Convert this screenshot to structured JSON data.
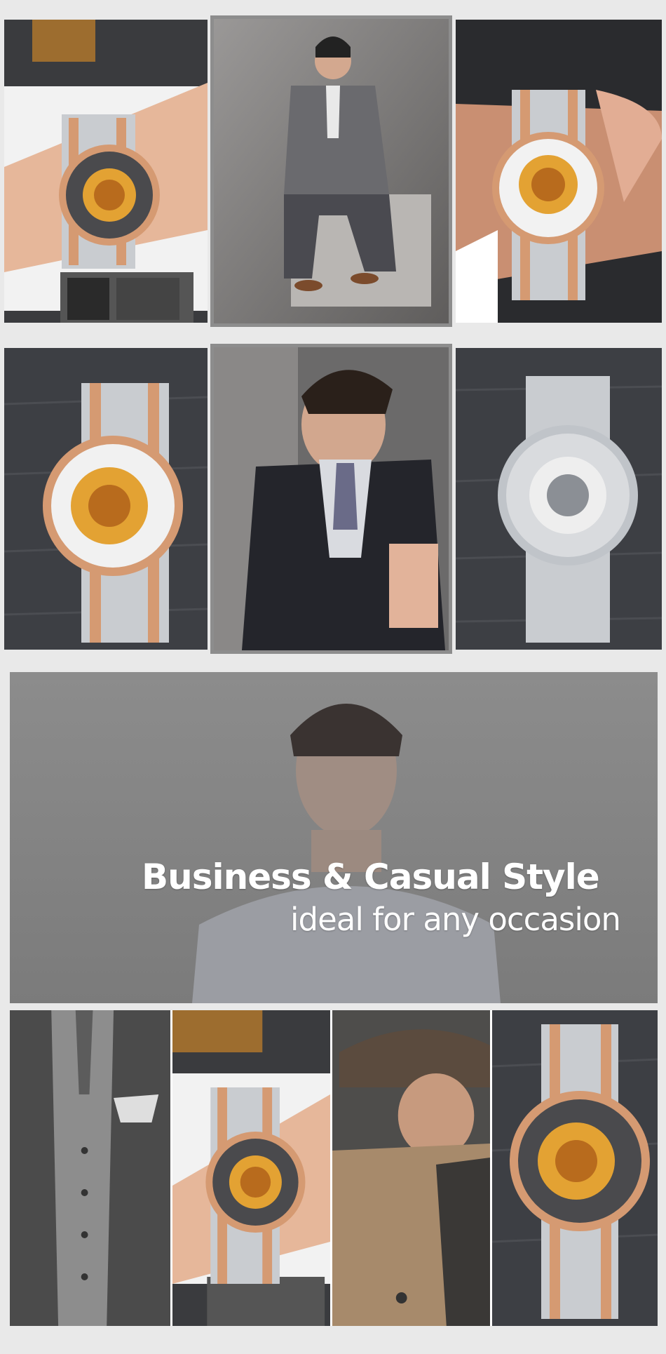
{
  "banner": {
    "headline": "Business & Casual Style",
    "subline": "ideal for any occasion"
  },
  "colors": {
    "rose_gold": "#d59a72",
    "steel": "#c9cdd2",
    "gold_movement": "#e3a233",
    "wood_dark": "#3d3f44",
    "suit_gray": "#6a6a6e"
  }
}
